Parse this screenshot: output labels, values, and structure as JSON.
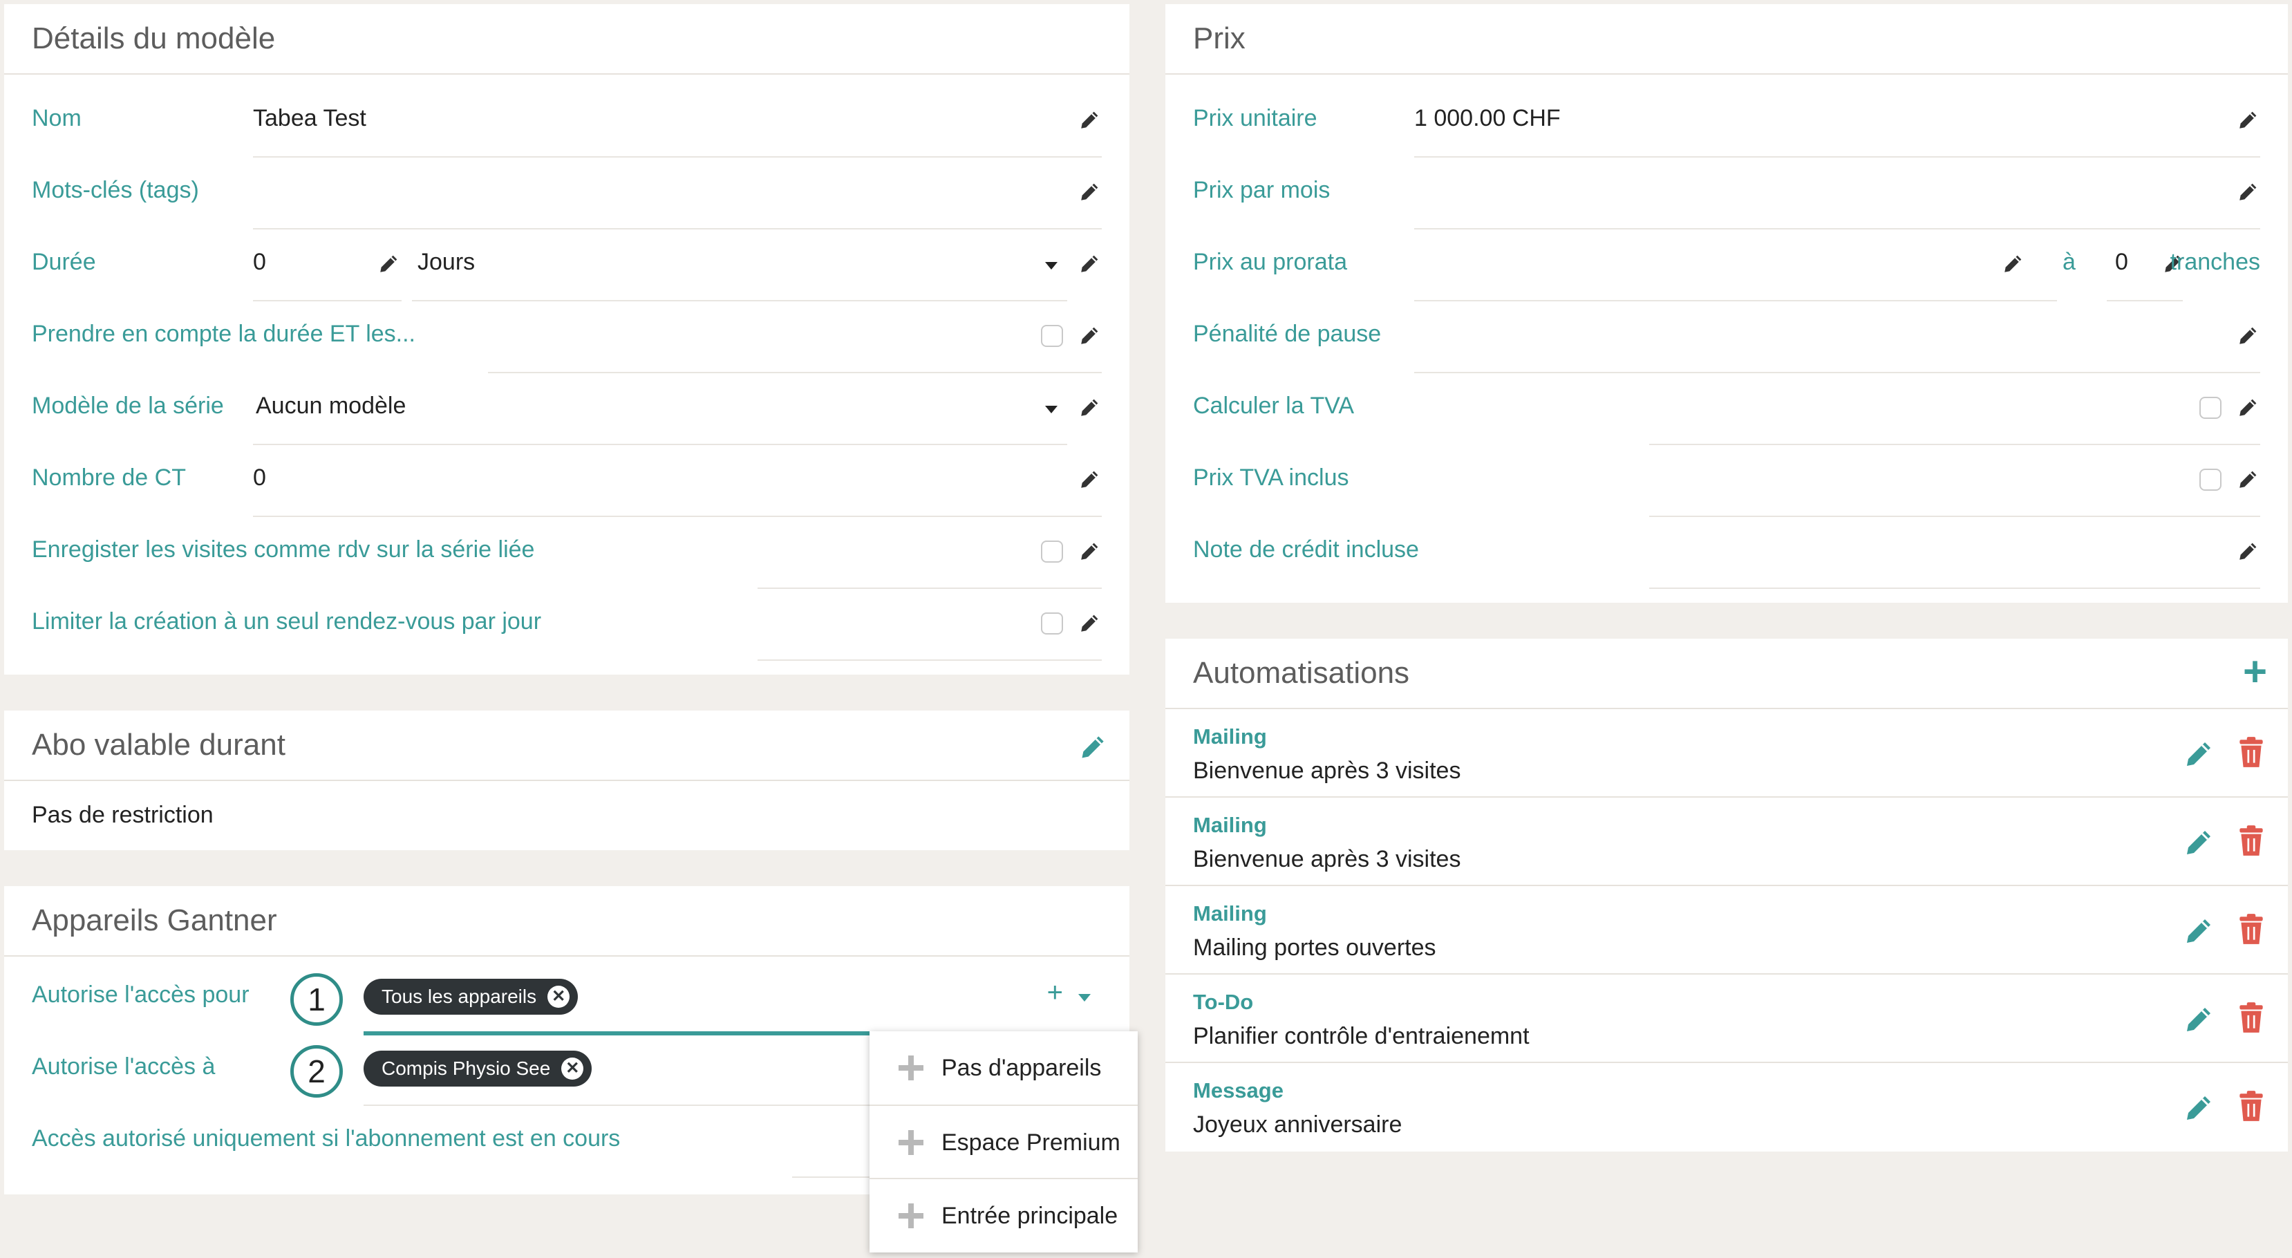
{
  "details": {
    "title": "Détails du modèle",
    "nom_label": "Nom",
    "nom_value": "Tabea Test",
    "tags_label": "Mots-clés (tags)",
    "duree_label": "Durée",
    "duree_value": "0",
    "duree_unit": "Jours",
    "prendre_label": "Prendre en compte la durée ET les...",
    "serie_label": "Modèle de la série",
    "serie_value": "Aucun modèle",
    "ct_label": "Nombre de CT",
    "ct_value": "0",
    "enregistrer_label": "Enregister les visites comme rdv sur la série liée",
    "limiter_label": "Limiter la création à un seul rendez-vous par jour"
  },
  "abo": {
    "title": "Abo valable durant",
    "value": "Pas de restriction"
  },
  "gantner": {
    "title": "Appareils Gantner",
    "acces_pour_label": "Autorise l'accès pour",
    "acces_pour_tag": "Tous les appareils",
    "acces_a_label": "Autorise l'accès à",
    "acces_a_tag": "Compis Physio See",
    "acces_abo_label": "Accès autorisé uniquement si l'abonnement est en cours",
    "marker_1": "1",
    "marker_2": "2"
  },
  "dropdown": {
    "items": [
      "Pas d'appareils",
      "Espace Premium",
      "Entrée principale"
    ]
  },
  "prix": {
    "title": "Prix",
    "unitaire_label": "Prix unitaire",
    "unitaire_value": "1 000.00 CHF",
    "mois_label": "Prix par mois",
    "prorata_label": "Prix au prorata",
    "prorata_a": "à",
    "prorata_count": "0",
    "prorata_tranches": "tranches",
    "penalite_label": "Pénalité de pause",
    "tva_label": "Calculer la TVA",
    "tva_inclus_label": "Prix TVA inclus",
    "credit_label": "Note de crédit incluse"
  },
  "automatisations": {
    "title": "Automatisations",
    "items": [
      {
        "type": "Mailing",
        "name": "Bienvenue après 3 visites"
      },
      {
        "type": "Mailing",
        "name": "Bienvenue après 3 visites"
      },
      {
        "type": "Mailing",
        "name": "Mailing portes ouvertes"
      },
      {
        "type": "To-Do",
        "name": "Planifier contrôle d'entraienemnt"
      },
      {
        "type": "Message",
        "name": "Joyeux anniversaire"
      }
    ]
  },
  "colors": {
    "accent": "#3a9b98",
    "delete": "#e05a4e",
    "background": "#f2efeb"
  }
}
